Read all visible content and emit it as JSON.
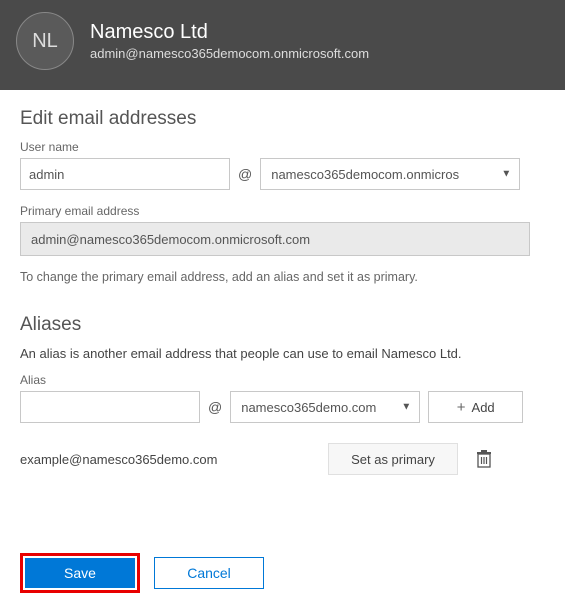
{
  "header": {
    "initials": "NL",
    "title": "Namesco Ltd",
    "subtitle": "admin@namesco365democom.onmicrosoft.com"
  },
  "edit": {
    "section_title": "Edit email addresses",
    "username_label": "User name",
    "username_value": "admin",
    "at": "@",
    "username_domain": "namesco365democom.onmicros",
    "primary_label": "Primary email address",
    "primary_value": "admin@namesco365democom.onmicrosoft.com",
    "primary_hint": "To change the primary email address, add an alias and set it as primary."
  },
  "aliases": {
    "section_title": "Aliases",
    "description": "An alias is another email address that people can use to email Namesco Ltd.",
    "alias_label": "Alias",
    "alias_value": "",
    "alias_domain": "namesco365demo.com",
    "add_label": "Add",
    "list": [
      {
        "email": "example@namesco365demo.com",
        "set_primary_label": "Set as primary"
      }
    ]
  },
  "footer": {
    "save": "Save",
    "cancel": "Cancel"
  }
}
